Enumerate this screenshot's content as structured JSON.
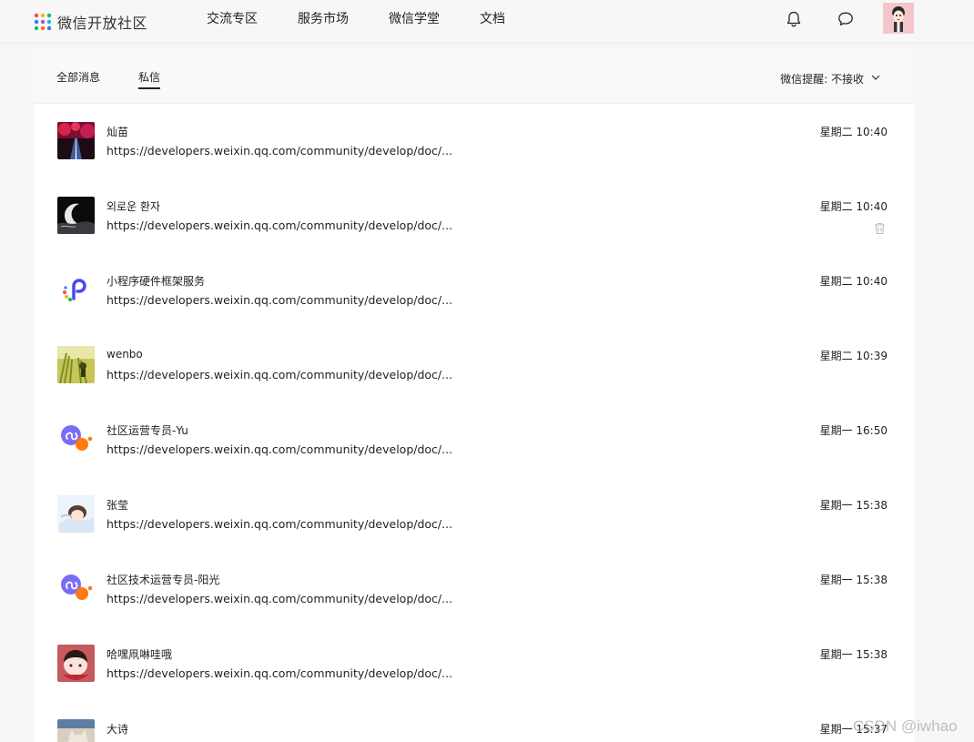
{
  "header": {
    "logo_text": "微信开放社区",
    "nav": [
      "交流专区",
      "服务市场",
      "微信学堂",
      "文档"
    ]
  },
  "tabs": {
    "all": "全部消息",
    "private": "私信"
  },
  "notify": {
    "label": "微信提醒: 不接收"
  },
  "messages": [
    {
      "name": "灿苗",
      "link": "https://developers.weixin.qq.com/community/develop/doc/...",
      "time": "星期二 10:40",
      "avatar": "photo-red-street"
    },
    {
      "name": "외로운 환자",
      "link": "https://developers.weixin.qq.com/community/develop/doc/...",
      "time": "星期二 10:40",
      "avatar": "photo-dark-moon"
    },
    {
      "name": "小程序硬件框架服务",
      "link": "https://developers.weixin.qq.com/community/develop/doc/...",
      "time": "星期二 10:40",
      "avatar": "logo-mini-program-hardware"
    },
    {
      "name": "wenbo",
      "link": "https://developers.weixin.qq.com/community/develop/doc/...",
      "time": "星期二 10:39",
      "avatar": "photo-yellow-plants"
    },
    {
      "name": "社区运营专员-Yu",
      "link": "https://developers.weixin.qq.com/community/develop/doc/...",
      "time": "星期一 16:50",
      "avatar": "logo-mini-program-purple"
    },
    {
      "name": "张莹",
      "link": "https://developers.weixin.qq.com/community/develop/doc/...",
      "time": "星期一 15:38",
      "avatar": "illustration-sleeping"
    },
    {
      "name": "社区技术运营专员-阳光",
      "link": "https://developers.weixin.qq.com/community/develop/doc/...",
      "time": "星期一 15:38",
      "avatar": "logo-mini-program-purple"
    },
    {
      "name": "哈嘿凧啉哇哦",
      "link": "https://developers.weixin.qq.com/community/develop/doc/...",
      "time": "星期一 15:38",
      "avatar": "illustration-red-face"
    },
    {
      "name": "大诗",
      "link": "",
      "time": "星期一 15:37",
      "avatar": "photo-cat"
    }
  ],
  "watermark": "CSDN @iwhao",
  "colors": {
    "background": "#f7f7f7",
    "panel": "#ffffff",
    "text": "#222222",
    "mini_program_purple": "#7b6cf6",
    "mini_program_orange": "#ff7a12"
  }
}
